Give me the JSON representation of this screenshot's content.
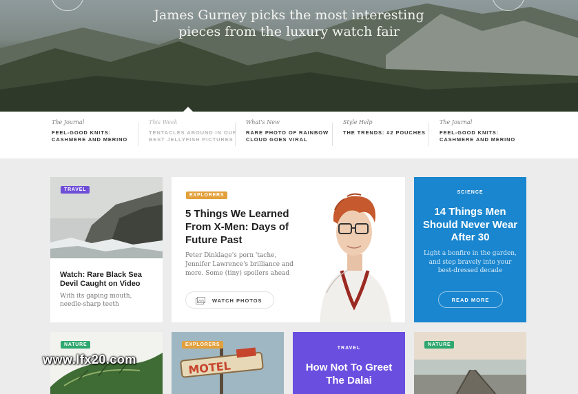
{
  "hero": {
    "subtitle_line1": "James Gurney picks the most interesting",
    "subtitle_line2": "pieces from the luxury watch fair"
  },
  "strip": [
    {
      "kicker": "The Journal",
      "headline": "FEEL-GOOD KNITS: CASHMERE AND MERINO",
      "muted": false
    },
    {
      "kicker": "This Week",
      "headline": "TENTACLES ABOUND IN OUR BEST JELLYFISH PICTURES",
      "muted": true
    },
    {
      "kicker": "What's New",
      "headline": "RARE PHOTO OF RAINBOW CLOUD GOES VIRAL",
      "muted": false
    },
    {
      "kicker": "Style Help",
      "headline": "THE TRENDS: #2 POUCHES",
      "muted": false
    },
    {
      "kicker": "The Journal",
      "headline": "FEEL-GOOD KNITS: CASHMERE AND MERINO",
      "muted": false
    }
  ],
  "cards": {
    "sea_devil": {
      "tag": "TRAVEL",
      "title": "Watch: Rare Black Sea Devil Caught on Video",
      "description": "With its gaping mouth, needle-sharp teeth"
    },
    "xmen": {
      "tag": "EXPLORERS",
      "title": "5 Things We Learned From X-Men: Days of Future Past",
      "description": "Peter Dinklage's porn 'tache, Jennifer Lawrence's brilliance and more. Some (tiny) spoilers ahead",
      "button": "WATCH PHOTOS"
    },
    "science": {
      "tag": "SCIENCE",
      "title": "14 Things Men Should Never Wear After 30",
      "description": "Light a bonfire in the garden, and step bravely into your best-dressed decade",
      "button": "READ MORE"
    },
    "nature_leaf": {
      "tag": "NATURE"
    },
    "motel": {
      "tag": "EXPLORERS"
    },
    "dalai": {
      "tag": "TRAVEL",
      "title": "How Not To Greet The Dalai"
    },
    "pier": {
      "tag": "NATURE"
    }
  },
  "watermark": "www.lfx20.com",
  "colors": {
    "travel": "#6f4fd8",
    "explorers": "#e2a03b",
    "nature": "#2fa86f",
    "science_bg": "#1a86cf",
    "dalai_bg": "#6a4ee0"
  }
}
